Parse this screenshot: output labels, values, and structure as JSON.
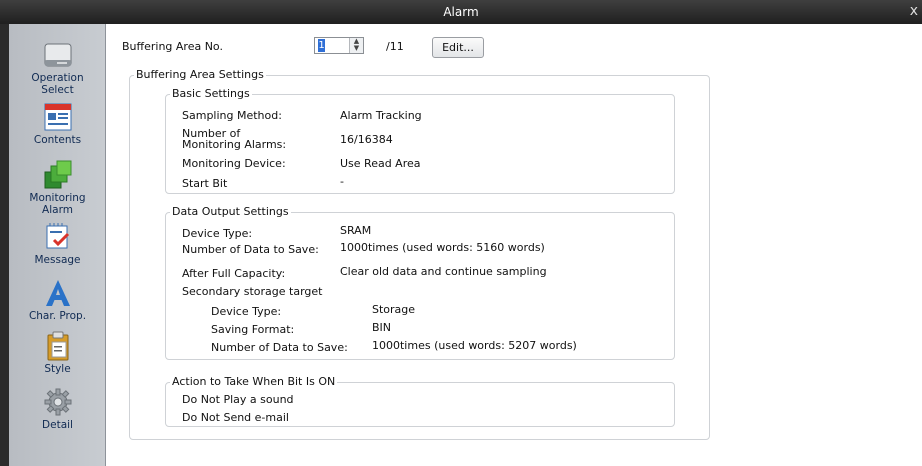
{
  "window": {
    "title": "Alarm",
    "close_label": "x"
  },
  "sidebar": {
    "items": [
      {
        "label_1": "Operation",
        "label_2": "Select",
        "icon": "monitor-icon"
      },
      {
        "label_1": "Contents",
        "label_2": "",
        "icon": "contents-icon"
      },
      {
        "label_1": "Monitoring",
        "label_2": "Alarm",
        "icon": "monitoring-alarm-icon"
      },
      {
        "label_1": "Message",
        "label_2": "",
        "icon": "message-icon"
      },
      {
        "label_1": "Char. Prop.",
        "label_2": "",
        "icon": "char-prop-icon"
      },
      {
        "label_1": "Style",
        "label_2": "",
        "icon": "style-icon"
      },
      {
        "label_1": "Detail",
        "label_2": "",
        "icon": "gear-icon"
      }
    ]
  },
  "buffering": {
    "area_label": "Buffering Area No.",
    "area_value": "1",
    "area_total": "/11",
    "edit_label": "Edit..."
  },
  "settings": {
    "group_title": "Buffering Area Settings",
    "basic": {
      "title": "Basic Settings",
      "rows": [
        {
          "label": "Sampling Method:",
          "value": "Alarm Tracking"
        },
        {
          "label": "Number of Monitoring Alarms:",
          "value": "16/16384"
        },
        {
          "label": "Monitoring Device:",
          "value": "Use Read Area"
        },
        {
          "label": "Start Bit",
          "value": "-"
        }
      ]
    },
    "output": {
      "title": "Data Output Settings",
      "rows": [
        {
          "label": "Device Type:",
          "value": "SRAM"
        },
        {
          "label": "Number of Data to Save:",
          "value": "1000times (used words: 5160 words)"
        },
        {
          "label": "After Full Capacity:",
          "value": "Clear old data and continue sampling"
        }
      ],
      "secondary_title": "Secondary storage target",
      "secondary_rows": [
        {
          "label": "Device Type:",
          "value": "Storage"
        },
        {
          "label": "Saving Format:",
          "value": "BIN"
        },
        {
          "label": "Number of Data to Save:",
          "value": "1000times (used words: 5207 words)"
        }
      ]
    },
    "action": {
      "title": "Action to Take When Bit Is ON",
      "rows": [
        "Do Not Play a sound",
        "Do Not Send e-mail"
      ]
    }
  },
  "colors": {
    "titlebar": "#2a2a2a",
    "sidebar": "#c0c4c9",
    "accent": "#2f6fd6"
  }
}
